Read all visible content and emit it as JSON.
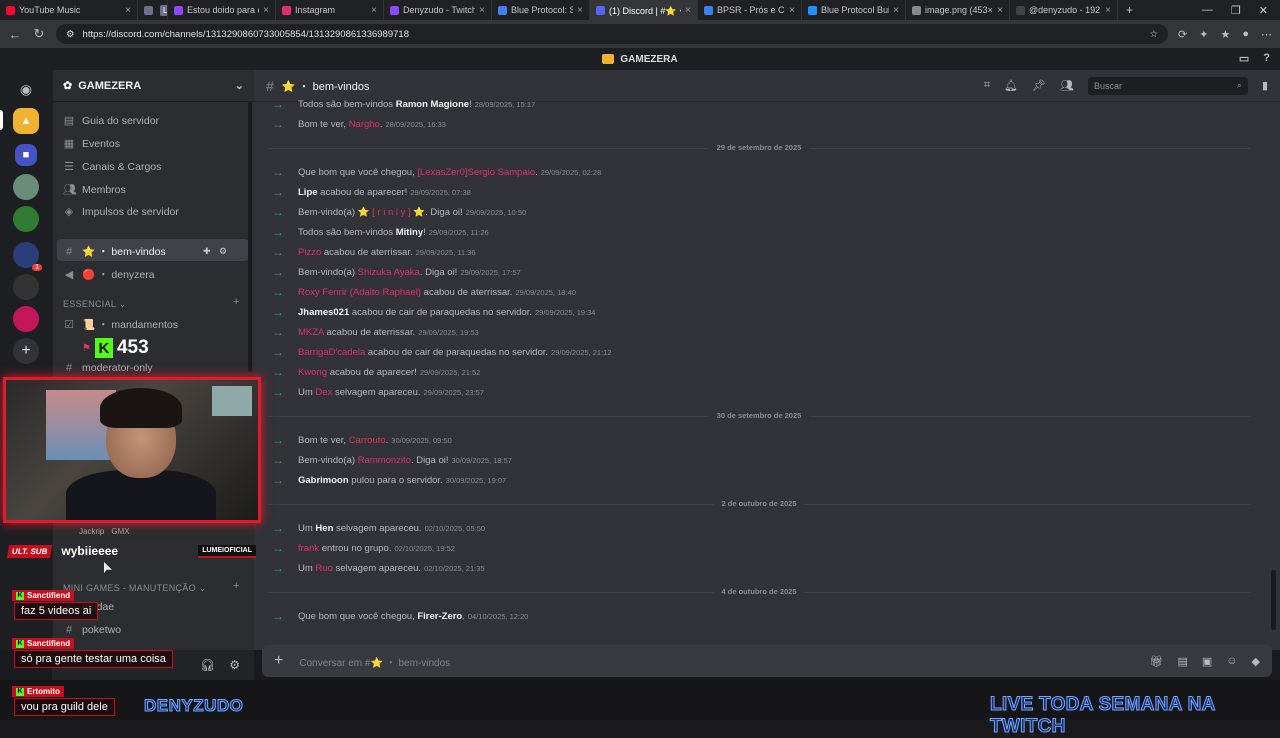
{
  "browser": {
    "tabs": [
      {
        "title": "YouTube Music",
        "color": "#ff0033",
        "active": false
      },
      {
        "title": "",
        "live": "LIVE",
        "color": "#6e6e8e",
        "active": false
      },
      {
        "title": "Estou doido para c",
        "color": "#9146ff",
        "active": false
      },
      {
        "title": "Instagram",
        "color": "#e1306c",
        "active": false
      },
      {
        "title": "Denyzudo - Twitch",
        "color": "#9146ff",
        "active": false
      },
      {
        "title": "Blue Protocol: Star",
        "color": "#3b82f6",
        "active": false
      },
      {
        "title": "(1) Discord | #⭐・",
        "color": "#5865f2",
        "active": true
      },
      {
        "title": "BPSR - Prós e Con",
        "color": "#3b82f6",
        "active": false
      },
      {
        "title": "Blue Protocol Build",
        "color": "#1e90ff",
        "active": false
      },
      {
        "title": "image.png (453×6",
        "color": "#888888",
        "active": false
      },
      {
        "title": "@denyzudo - 192",
        "color": "#444444",
        "active": false
      }
    ],
    "url": "https://discord.com/channels/1313290860733005854/1313290861336989718"
  },
  "discord": {
    "top_title": "GAMEZERA",
    "server_name": "GAMEZERA",
    "sidebar_items": [
      {
        "icon": "book-icon",
        "label": "Guia do servidor"
      },
      {
        "icon": "calendar-icon",
        "label": "Eventos"
      },
      {
        "icon": "list-icon",
        "label": "Canais & Cargos"
      },
      {
        "icon": "members-icon",
        "label": "Membros"
      },
      {
        "icon": "boost-icon",
        "label": "Impulsos de servidor"
      }
    ],
    "channels": [
      {
        "name": "⭐ ・ bem-vindos",
        "active": true
      },
      {
        "name": "🔴 ・ denyzera",
        "active": false
      }
    ],
    "category_essencial": "ESSENCIAL",
    "essencial_channels": [
      {
        "name": "📜 ・ mandamentos"
      },
      {
        "name": "moderator-only"
      }
    ],
    "category_minigames": "MINI GAMES - MANUTENÇÃO",
    "minigames_channels": [
      {
        "name": "mudae"
      },
      {
        "name": "poketwo"
      }
    ],
    "voice_user": "Jackrip",
    "voice_tag": "GMX",
    "channel_header": "⭐ ・ bem-vindos",
    "search_placeholder": "Buscar",
    "composer_placeholder": "Conversar em #⭐ ・ bem-vindos",
    "dates": [
      "29 de setembro de 2025",
      "30 de setembro de 2025",
      "2 de outubro de 2025",
      "4 de outubro de 2025"
    ],
    "messages": [
      {
        "pre": "Todos são bem-vindos ",
        "name": "Ramon Magione",
        "red": false,
        "post": "!",
        "ts": "28/09/2025, 15:17"
      },
      {
        "pre": "Bom te ver, ",
        "name": "Nargho",
        "red": true,
        "post": ".",
        "ts": "28/09/2025, 16:33"
      },
      {
        "pre": "Que bom que você chegou, ",
        "name": "[LexasZer0]Sergio Sampaio",
        "red": true,
        "post": ".",
        "ts": "29/09/2025, 02:28"
      },
      {
        "pre": "",
        "name": "Lipe",
        "red": false,
        "post": " acabou de aparecer!",
        "ts": "29/09/2025, 07:38"
      },
      {
        "pre": "Bem-vindo(a) ⭐ ",
        "name": "[ r i n l y ]",
        "red": true,
        "post": " ⭐. Diga oi!",
        "ts": "29/09/2025, 10:50"
      },
      {
        "pre": "Todos são bem-vindos ",
        "name": "Mitiny",
        "red": false,
        "post": "!",
        "ts": "29/09/2025, 11:26"
      },
      {
        "pre": "",
        "name": "Pizzo",
        "red": true,
        "post": " acabou de aterrissar.",
        "ts": "29/09/2025, 11:36"
      },
      {
        "pre": "Bem-vindo(a) ",
        "name": "Shizuka Ayaka",
        "red": true,
        "post": ". Diga oi!",
        "ts": "29/09/2025, 17:57"
      },
      {
        "pre": "",
        "name": "Roxy Fenrir (Adalto Raphael)",
        "red": true,
        "post": " acabou de aterrissar.",
        "ts": "29/09/2025, 18:40"
      },
      {
        "pre": "",
        "name": "Jhames021",
        "red": false,
        "post": " acabou de cair de paraquedas no servidor.",
        "ts": "29/09/2025, 19:34"
      },
      {
        "pre": "",
        "name": "MKZA",
        "red": true,
        "post": " acabou de aterrissar.",
        "ts": "29/09/2025, 19:53"
      },
      {
        "pre": "",
        "name": "BarrigaD'cadela",
        "red": true,
        "post": " acabou de cair de paraquedas no servidor.",
        "ts": "29/09/2025, 21:12"
      },
      {
        "pre": "",
        "name": "Kwong",
        "red": true,
        "post": " acabou de aparecer!",
        "ts": "29/09/2025, 21:52"
      },
      {
        "pre": "Um ",
        "name": "Dex",
        "red": true,
        "post": " selvagem apareceu.",
        "ts": "29/09/2025, 23:57"
      },
      {
        "pre": "Bom te ver, ",
        "name": "Carrouto",
        "red": true,
        "post": ".",
        "ts": "30/09/2025, 09:50"
      },
      {
        "pre": "Bem-vindo(a) ",
        "name": "Rammonzito",
        "red": true,
        "post": ". Diga oi!",
        "ts": "30/09/2025, 18:57"
      },
      {
        "pre": "",
        "name": "Gabrimoon",
        "red": false,
        "post": " pulou para o servidor.",
        "ts": "30/09/2025, 19:07"
      },
      {
        "pre": "Um ",
        "name": "Hen",
        "red": false,
        "post": " selvagem apareceu.",
        "ts": "02/10/2025, 05:50"
      },
      {
        "pre": "",
        "name": "frank",
        "red": true,
        "post": " entrou no grupo.",
        "ts": "02/10/2025, 19:52"
      },
      {
        "pre": "Um ",
        "name": "Ruo",
        "red": true,
        "post": " selvagem apareceu.",
        "ts": "02/10/2025, 21:35"
      },
      {
        "pre": "Que bom que você chegou, ",
        "name": "Firer-Zero",
        "red": false,
        "post": ".",
        "ts": "04/10/2025, 12:20"
      }
    ]
  },
  "overlay": {
    "follower_count": "453",
    "sub_logo": "ULT. SUB",
    "sub_name": "wybiieeee",
    "sub_brand": "LUMEIOFICIAL",
    "chat": [
      {
        "user": "Sanctifiend",
        "text": "faz 5 videos ai"
      },
      {
        "user": "Sanctifiend",
        "text": "só pra gente testar uma coisa"
      },
      {
        "user": "Ertomito",
        "text": "vou pra guild dele"
      }
    ],
    "streamer_logo": "DENYZUDO",
    "live_banner": "LIVE TODA SEMANA NA TWITCH"
  },
  "colors": {
    "accent_red": "#e0336a",
    "join_arrow": "#3ba55d",
    "overlay_red": "#c40f1f",
    "kick_green": "#53fc18"
  }
}
